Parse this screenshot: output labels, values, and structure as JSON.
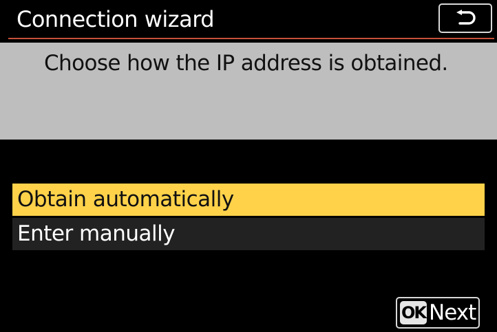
{
  "header": {
    "title": "Connection wizard",
    "back_icon": "return-arrow-icon",
    "rule_color": "#c8503a"
  },
  "prompt": {
    "text": "Choose how the IP address is obtained.",
    "background": "#bebebe"
  },
  "menu": {
    "items": [
      {
        "label": "Obtain automatically",
        "selected": true
      },
      {
        "label": "Enter manually",
        "selected": false
      }
    ],
    "highlight_color": "#ffd24a"
  },
  "footer": {
    "ok_label": "OK",
    "next_label": "Next"
  }
}
